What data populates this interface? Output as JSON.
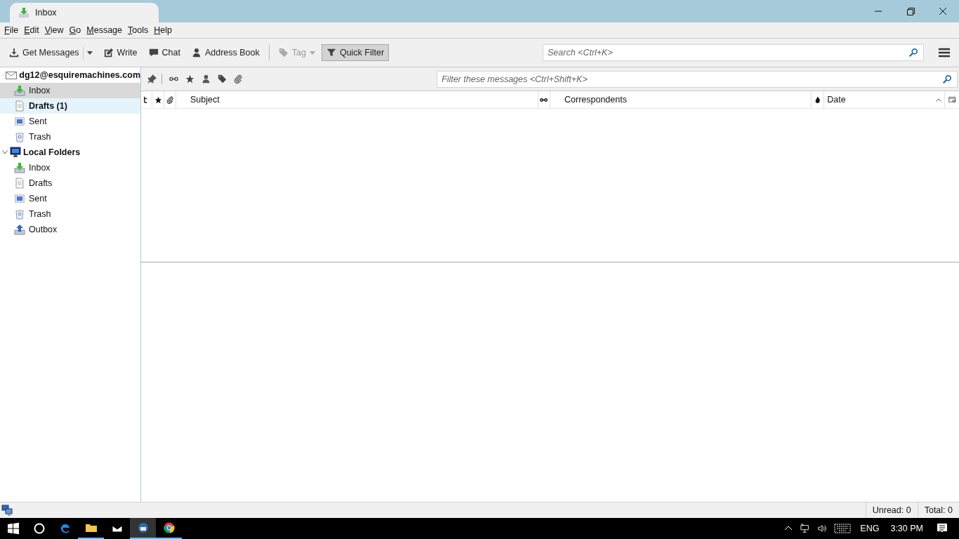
{
  "window": {
    "tab_title": "Inbox"
  },
  "menu": [
    {
      "label": "File"
    },
    {
      "label": "Edit"
    },
    {
      "label": "View"
    },
    {
      "label": "Go"
    },
    {
      "label": "Message"
    },
    {
      "label": "Tools"
    },
    {
      "label": "Help"
    }
  ],
  "toolbar": [
    {
      "kind": "split",
      "label": "Get Messages",
      "disabled": false,
      "selected": false
    },
    {
      "kind": "button",
      "label": "Write",
      "disabled": false,
      "selected": false
    },
    {
      "kind": "button",
      "label": "Chat",
      "disabled": false,
      "selected": false
    },
    {
      "kind": "button",
      "label": "Address Book",
      "disabled": false,
      "selected": false
    },
    {
      "kind": "separator"
    },
    {
      "kind": "menu",
      "label": "Tag",
      "disabled": true,
      "selected": false
    },
    {
      "kind": "button",
      "label": "Quick Filter",
      "disabled": false,
      "selected": true
    }
  ],
  "search": {
    "placeholder": "Search <Ctrl+K>"
  },
  "folders": [
    {
      "label": "dg12@esquiremachines.com",
      "expanded": true,
      "children": [
        {
          "label": "Inbox",
          "selected": true,
          "hover": false,
          "bold": false
        },
        {
          "label": "Drafts (1)",
          "selected": false,
          "hover": true,
          "bold": true
        },
        {
          "label": "Sent",
          "selected": false,
          "hover": false,
          "bold": false
        },
        {
          "label": "Trash",
          "selected": false,
          "hover": false,
          "bold": false
        }
      ]
    },
    {
      "label": "Local Folders",
      "expanded": true,
      "children": [
        {
          "label": "Inbox",
          "selected": false,
          "hover": false,
          "bold": false
        },
        {
          "label": "Drafts",
          "selected": false,
          "hover": false,
          "bold": false
        },
        {
          "label": "Sent",
          "selected": false,
          "hover": false,
          "bold": false
        },
        {
          "label": "Trash",
          "selected": false,
          "hover": false,
          "bold": false
        },
        {
          "label": "Outbox",
          "selected": false,
          "hover": false,
          "bold": false
        }
      ]
    }
  ],
  "quick_filter": {
    "placeholder": "Filter these messages <Ctrl+Shift+K>"
  },
  "columns": [
    {
      "kind": "icon"
    },
    {
      "kind": "icon"
    },
    {
      "kind": "icon"
    },
    {
      "kind": "text",
      "label": "Subject",
      "sorted": false
    },
    {
      "kind": "icon"
    },
    {
      "kind": "text",
      "label": "Correspondents",
      "sorted": false
    },
    {
      "kind": "icon"
    },
    {
      "kind": "text",
      "label": "Date",
      "sorted": true
    },
    {
      "kind": "picker"
    }
  ],
  "status_bar": {
    "unread": "Unread: 0",
    "total": "Total: 0"
  },
  "taskbar": {
    "apps": [
      {
        "active": false,
        "running": false
      },
      {
        "active": false,
        "running": false
      },
      {
        "active": false,
        "running": false
      },
      {
        "active": false,
        "running": true
      },
      {
        "active": false,
        "running": false
      },
      {
        "active": true,
        "running": true
      },
      {
        "active": false,
        "running": true
      }
    ],
    "language": "ENG",
    "time": "3:30 PM"
  }
}
